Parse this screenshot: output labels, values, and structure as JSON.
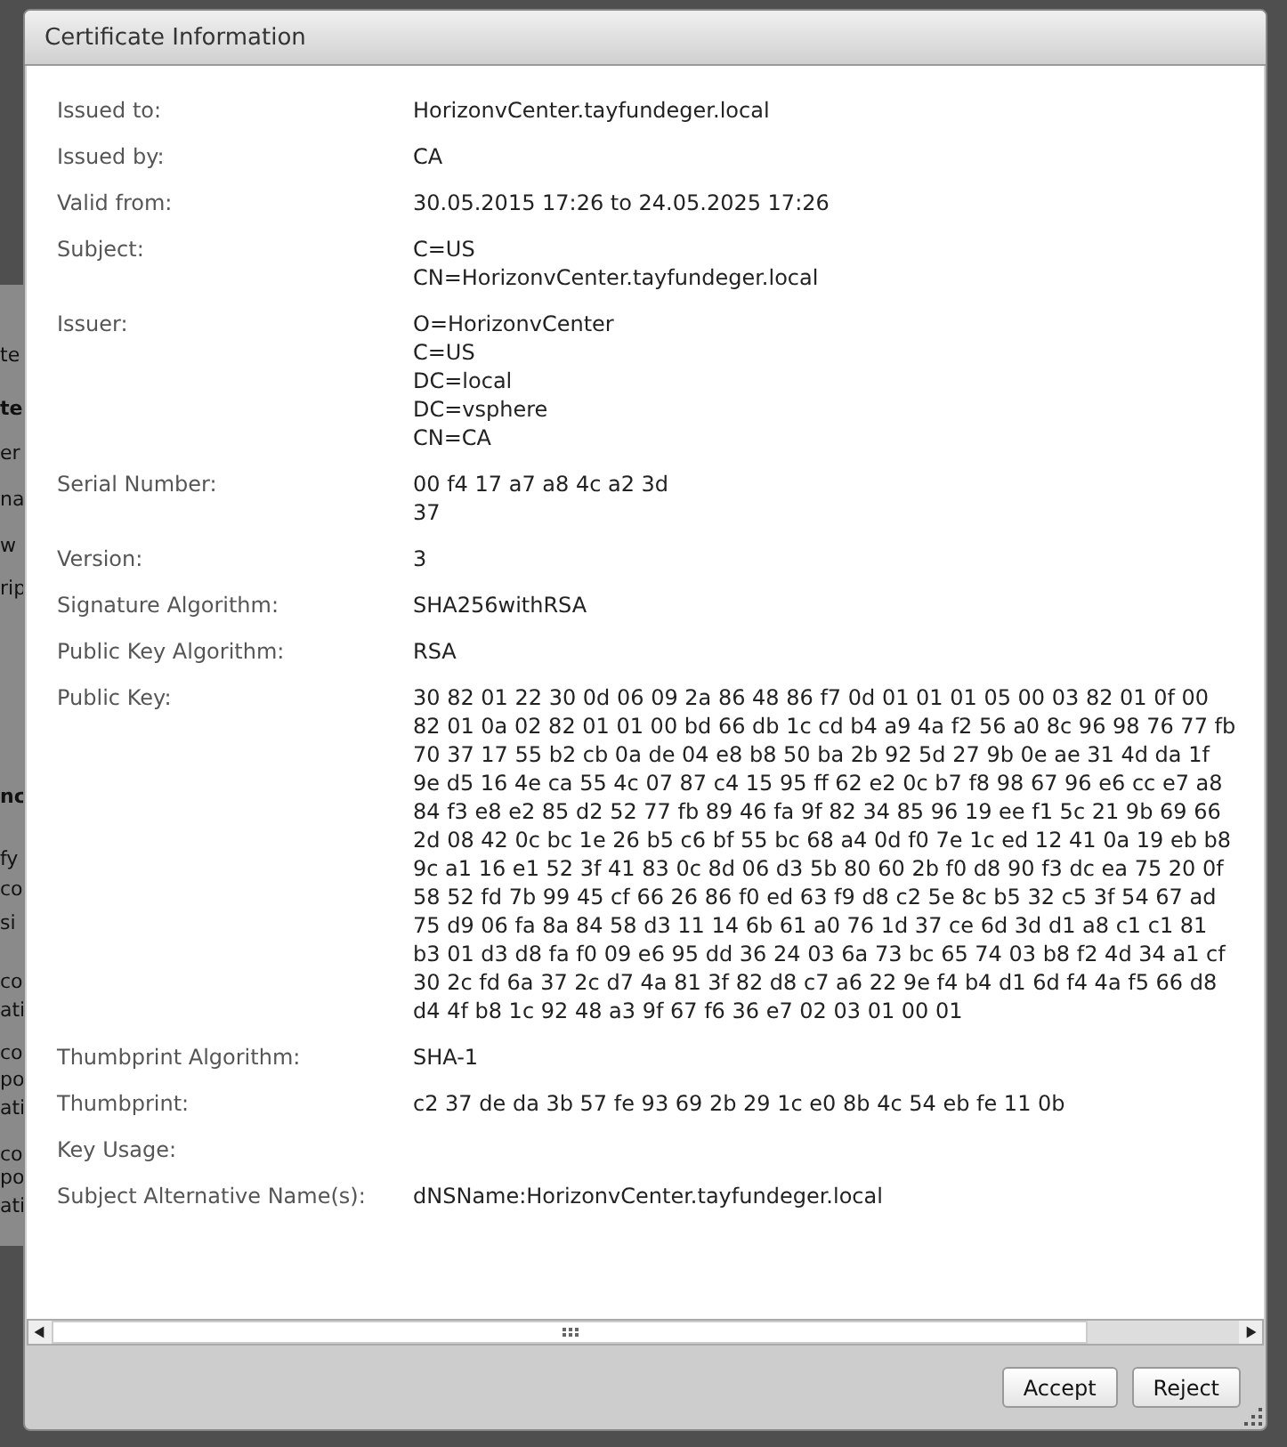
{
  "background_fragments": [
    {
      "text": "te",
      "bold": false
    },
    {
      "text": "te",
      "bold": true
    },
    {
      "text": "er",
      "bold": false
    },
    {
      "text": "na",
      "bold": false
    },
    {
      "text": "w",
      "bold": false
    },
    {
      "text": "rip",
      "bold": false
    },
    {
      "text": "nc",
      "bold": true
    },
    {
      "text": "fy",
      "bold": false
    },
    {
      "text": "co",
      "bold": false
    },
    {
      "text": "si",
      "bold": false
    },
    {
      "text": "co",
      "bold": false
    },
    {
      "text": "ati",
      "bold": false
    },
    {
      "text": "co",
      "bold": false
    },
    {
      "text": "po",
      "bold": false
    },
    {
      "text": "ati",
      "bold": false
    },
    {
      "text": "co",
      "bold": false
    },
    {
      "text": "po",
      "bold": false
    },
    {
      "text": "ati",
      "bold": false
    }
  ],
  "dialog": {
    "title": "Certificate Information",
    "fields": [
      {
        "label": "Issued to:",
        "value": [
          "HorizonvCenter.tayfundeger.local"
        ]
      },
      {
        "label": "Issued by:",
        "value": [
          "CA"
        ]
      },
      {
        "label": "Valid from:",
        "value": [
          "30.05.2015 17:26 to 24.05.2025 17:26"
        ]
      },
      {
        "label": "Subject:",
        "value": [
          "C=US",
          "CN=HorizonvCenter.tayfundeger.local"
        ]
      },
      {
        "label": "Issuer:",
        "value": [
          "O=HorizonvCenter",
          "C=US",
          "DC=local",
          "DC=vsphere",
          "CN=CA"
        ]
      },
      {
        "label": "Serial Number:",
        "value": [
          "00 f4 17 a7 a8 4c a2 3d",
          "37"
        ]
      },
      {
        "label": "Version:",
        "value": [
          "3"
        ]
      },
      {
        "label": "Signature Algorithm:",
        "value": [
          "SHA256withRSA"
        ]
      },
      {
        "label": "Public Key Algorithm:",
        "value": [
          "RSA"
        ]
      },
      {
        "label": "Public Key:",
        "value": [
          "30 82 01 22 30 0d 06 09 2a 86 48 86 f7 0d 01 01 01 05 00 03 82 01 0f 00",
          "82 01 0a 02 82 01 01 00 bd 66 db 1c cd b4 a9 4a f2 56 a0 8c 96 98 76 77 fb",
          "70 37 17 55 b2 cb 0a de 04 e8 b8 50 ba 2b 92 5d 27 9b 0e ae 31 4d da 1f",
          "9e d5 16 4e ca 55 4c 07 87 c4 15 95 ff 62 e2 0c b7 f8 98 67 96 e6 cc e7 a8",
          "84 f3 e8 e2 85 d2 52 77 fb 89 46 fa 9f 82 34 85 96 19 ee f1 5c 21 9b 69 66",
          "2d 08 42 0c bc 1e 26 b5 c6 bf 55 bc 68 a4 0d f0 7e 1c ed 12 41 0a 19 eb b8",
          "9c a1 16 e1 52 3f 41 83 0c 8d 06 d3 5b 80 60 2b f0 d8 90 f3 dc ea 75 20 0f",
          "58 52 fd 7b 99 45 cf 66 26 86 f0 ed 63 f9 d8 c2 5e 8c b5 32 c5 3f 54 67 ad",
          "75 d9 06 fa 8a 84 58 d3 11 14 6b 61 a0 76 1d 37 ce 6d 3d d1 a8 c1 c1 81",
          "b3 01 d3 d8 fa f0 09 e6 95 dd 36 24 03 6a 73 bc 65 74 03 b8 f2 4d 34 a1 cf",
          "30 2c fd 6a 37 2c d7 4a 81 3f 82 d8 c7 a6 22 9e f4 b4 d1 6d f4 4a f5 66 d8",
          "d4 4f b8 1c 92 48 a3 9f 67 f6 36 e7 02 03 01 00 01"
        ]
      },
      {
        "label": "Thumbprint Algorithm:",
        "value": [
          "SHA-1"
        ]
      },
      {
        "label": "Thumbprint:",
        "value": [
          "c2 37 de da 3b 57 fe 93 69 2b 29 1c e0 8b 4c 54 eb fe 11 0b"
        ]
      },
      {
        "label": "Key Usage:"
      },
      {
        "label": "Subject Alternative Name(s):",
        "value": [
          "dNSName:HorizonvCenter.tayfundeger.local"
        ]
      }
    ],
    "buttons": [
      "Accept",
      "Reject"
    ]
  }
}
